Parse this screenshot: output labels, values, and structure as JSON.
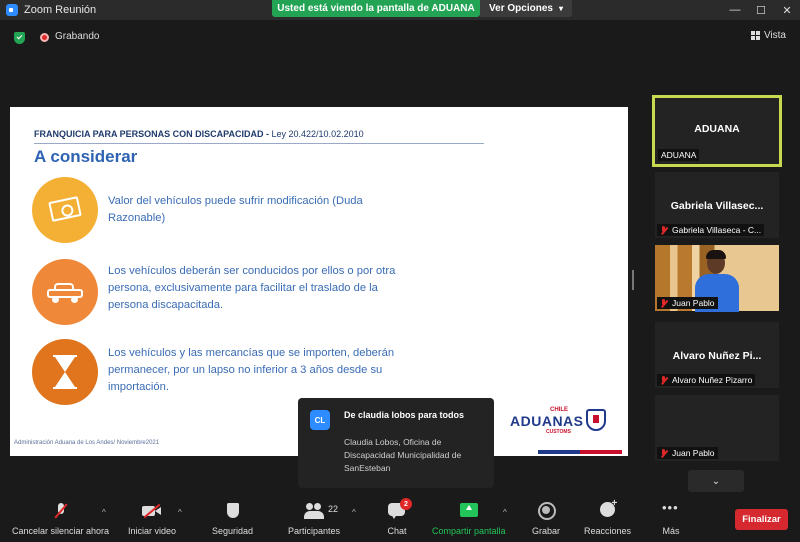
{
  "window": {
    "title": "Zoom Reunión",
    "minimize": "—",
    "maximize": "☐",
    "close": "✕"
  },
  "share_banner": {
    "text": "Usted está viendo la pantalla de ADUANA"
  },
  "view_options": {
    "label": "Ver Opciones",
    "icon": "chevron-down-icon"
  },
  "meeting": {
    "recording_label": "Grabando",
    "view_label": "Vista",
    "colors": {
      "secure": "#23a455",
      "recording": "#e02828"
    }
  },
  "slide": {
    "header_bold": "FRANQUICIA PARA PERSONAS CON DISCAPACIDAD -",
    "header_rest": " Ley 20.422/10.02.2010",
    "heading": "A considerar",
    "items": [
      {
        "icon": "money-icon",
        "text": "Valor del vehículos puede sufrir modificación (Duda Razonable)"
      },
      {
        "icon": "car-icon",
        "text": "Los vehículos deberán ser conducidos por ellos o por otra persona, exclusivamente para facilitar el traslado de la persona discapacitada."
      },
      {
        "icon": "hourglass-icon",
        "text": "Los vehículos y las mercancías que se importen, deberán permanecer, por un lapso no inferior a 3 años desde su importación."
      }
    ],
    "footer": "Administración Aduana de Los Andes/ Noviembre2021",
    "logo": {
      "top": "CHILE",
      "name": "ADUANAS",
      "sub": "CUSTOMS"
    }
  },
  "chat_toast": {
    "avatar": "CL",
    "from": "De claudia lobos para todos",
    "message": "Claudia Lobos, Oficina de Discapacidad Municipalidad de SanEsteban"
  },
  "participants": [
    {
      "center": "ADUANA",
      "label": "ADUANA",
      "muted": false,
      "active": true
    },
    {
      "center": "Gabriela  Villasec...",
      "label": "Gabriela Villaseca - C...",
      "muted": true,
      "active": false
    },
    {
      "center": "",
      "label": "Juan Pablo",
      "muted": true,
      "active": false,
      "video": true
    },
    {
      "center": "Alvaro Nuñez Pi...",
      "label": "Alvaro Nuñez Pizarro",
      "muted": true,
      "active": false
    },
    {
      "center": "",
      "label": "Juan Pablo",
      "muted": true,
      "active": false
    }
  ],
  "scroll_down": "⌄",
  "toolbar": {
    "unmute": "Cancelar silenciar ahora",
    "video": "Iniciar video",
    "security": "Seguridad",
    "participants": "Participantes",
    "participants_count": "22",
    "chat": "Chat",
    "chat_badge": "2",
    "share": "Compartir pantalla",
    "record": "Grabar",
    "reactions": "Reacciones",
    "more": "Más",
    "caret": "^",
    "end": "Finalizar"
  }
}
